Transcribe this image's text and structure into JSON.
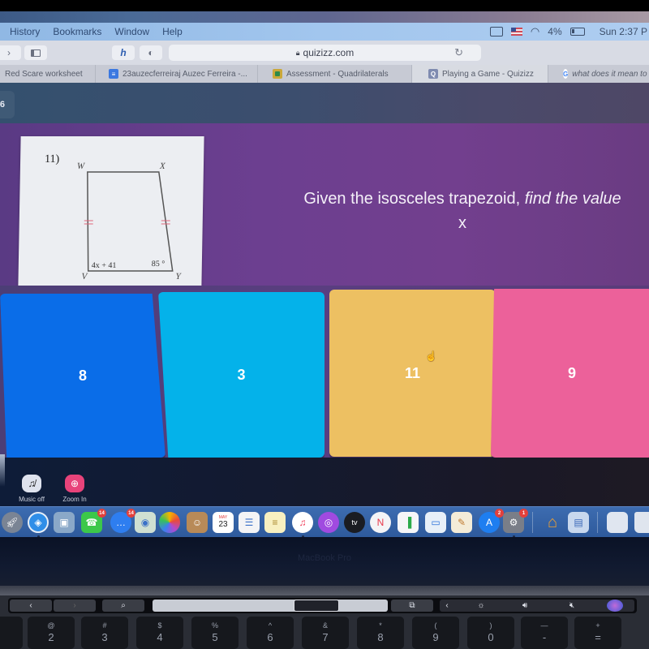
{
  "menubar": {
    "items": [
      "History",
      "Bookmarks",
      "Window",
      "Help"
    ],
    "battery_percent": "4%",
    "clock": "Sun 2:37 P"
  },
  "toolbar": {
    "address": "quizizz.com",
    "lock_icon": "lock-icon"
  },
  "tabs": [
    {
      "label": "Red Scare worksheet",
      "favicon": "",
      "active": false
    },
    {
      "label": "23auzecferreiraj Auzec Ferreira -...",
      "favicon": "docs-icon",
      "active": false
    },
    {
      "label": "Assessment - Quadrilaterals",
      "favicon": "classroom-icon",
      "active": false
    },
    {
      "label": "Playing a Game - Quizizz",
      "favicon": "Q",
      "active": true
    },
    {
      "label": "what does it mean to b",
      "favicon": "G",
      "active": false
    }
  ],
  "quiz": {
    "question_number": "6",
    "problem": {
      "number": "11)",
      "vertex_w": "W",
      "vertex_x": "X",
      "vertex_v": "V",
      "vertex_y": "Y",
      "angle_v": "4x + 41",
      "angle_y": "85 °"
    },
    "question_text_normal": "Given the isosceles trapezoid, ",
    "question_text_italic": "find the value",
    "question_text_line2": "x",
    "answers": [
      {
        "label": "8",
        "color": "#0a6de8"
      },
      {
        "label": "3",
        "color": "#04b2ea"
      },
      {
        "label": "11",
        "color": "#edc062"
      },
      {
        "label": "9",
        "color": "#ec619a"
      }
    ],
    "controls": {
      "music_label": "Music off",
      "zoom_label": "Zoom In"
    }
  },
  "dock": {
    "badges": {
      "facetime": "14",
      "messages": "14",
      "appstore": "2",
      "settings": "1"
    },
    "calendar_month": "MAY",
    "calendar_day": "23",
    "tv_label": "tv"
  },
  "laptop": {
    "brand": "MacBook Pro",
    "keys": [
      {
        "top": "!",
        "bot": ""
      },
      {
        "top": "@",
        "bot": "2"
      },
      {
        "top": "#",
        "bot": "3"
      },
      {
        "top": "$",
        "bot": "4"
      },
      {
        "top": "%",
        "bot": "5"
      },
      {
        "top": "^",
        "bot": "6"
      },
      {
        "top": "&",
        "bot": "7"
      },
      {
        "top": "*",
        "bot": "8"
      },
      {
        "top": "(",
        "bot": "9"
      },
      {
        "top": ")",
        "bot": "0"
      },
      {
        "top": "—",
        "bot": "-"
      },
      {
        "top": "+",
        "bot": "="
      }
    ]
  }
}
